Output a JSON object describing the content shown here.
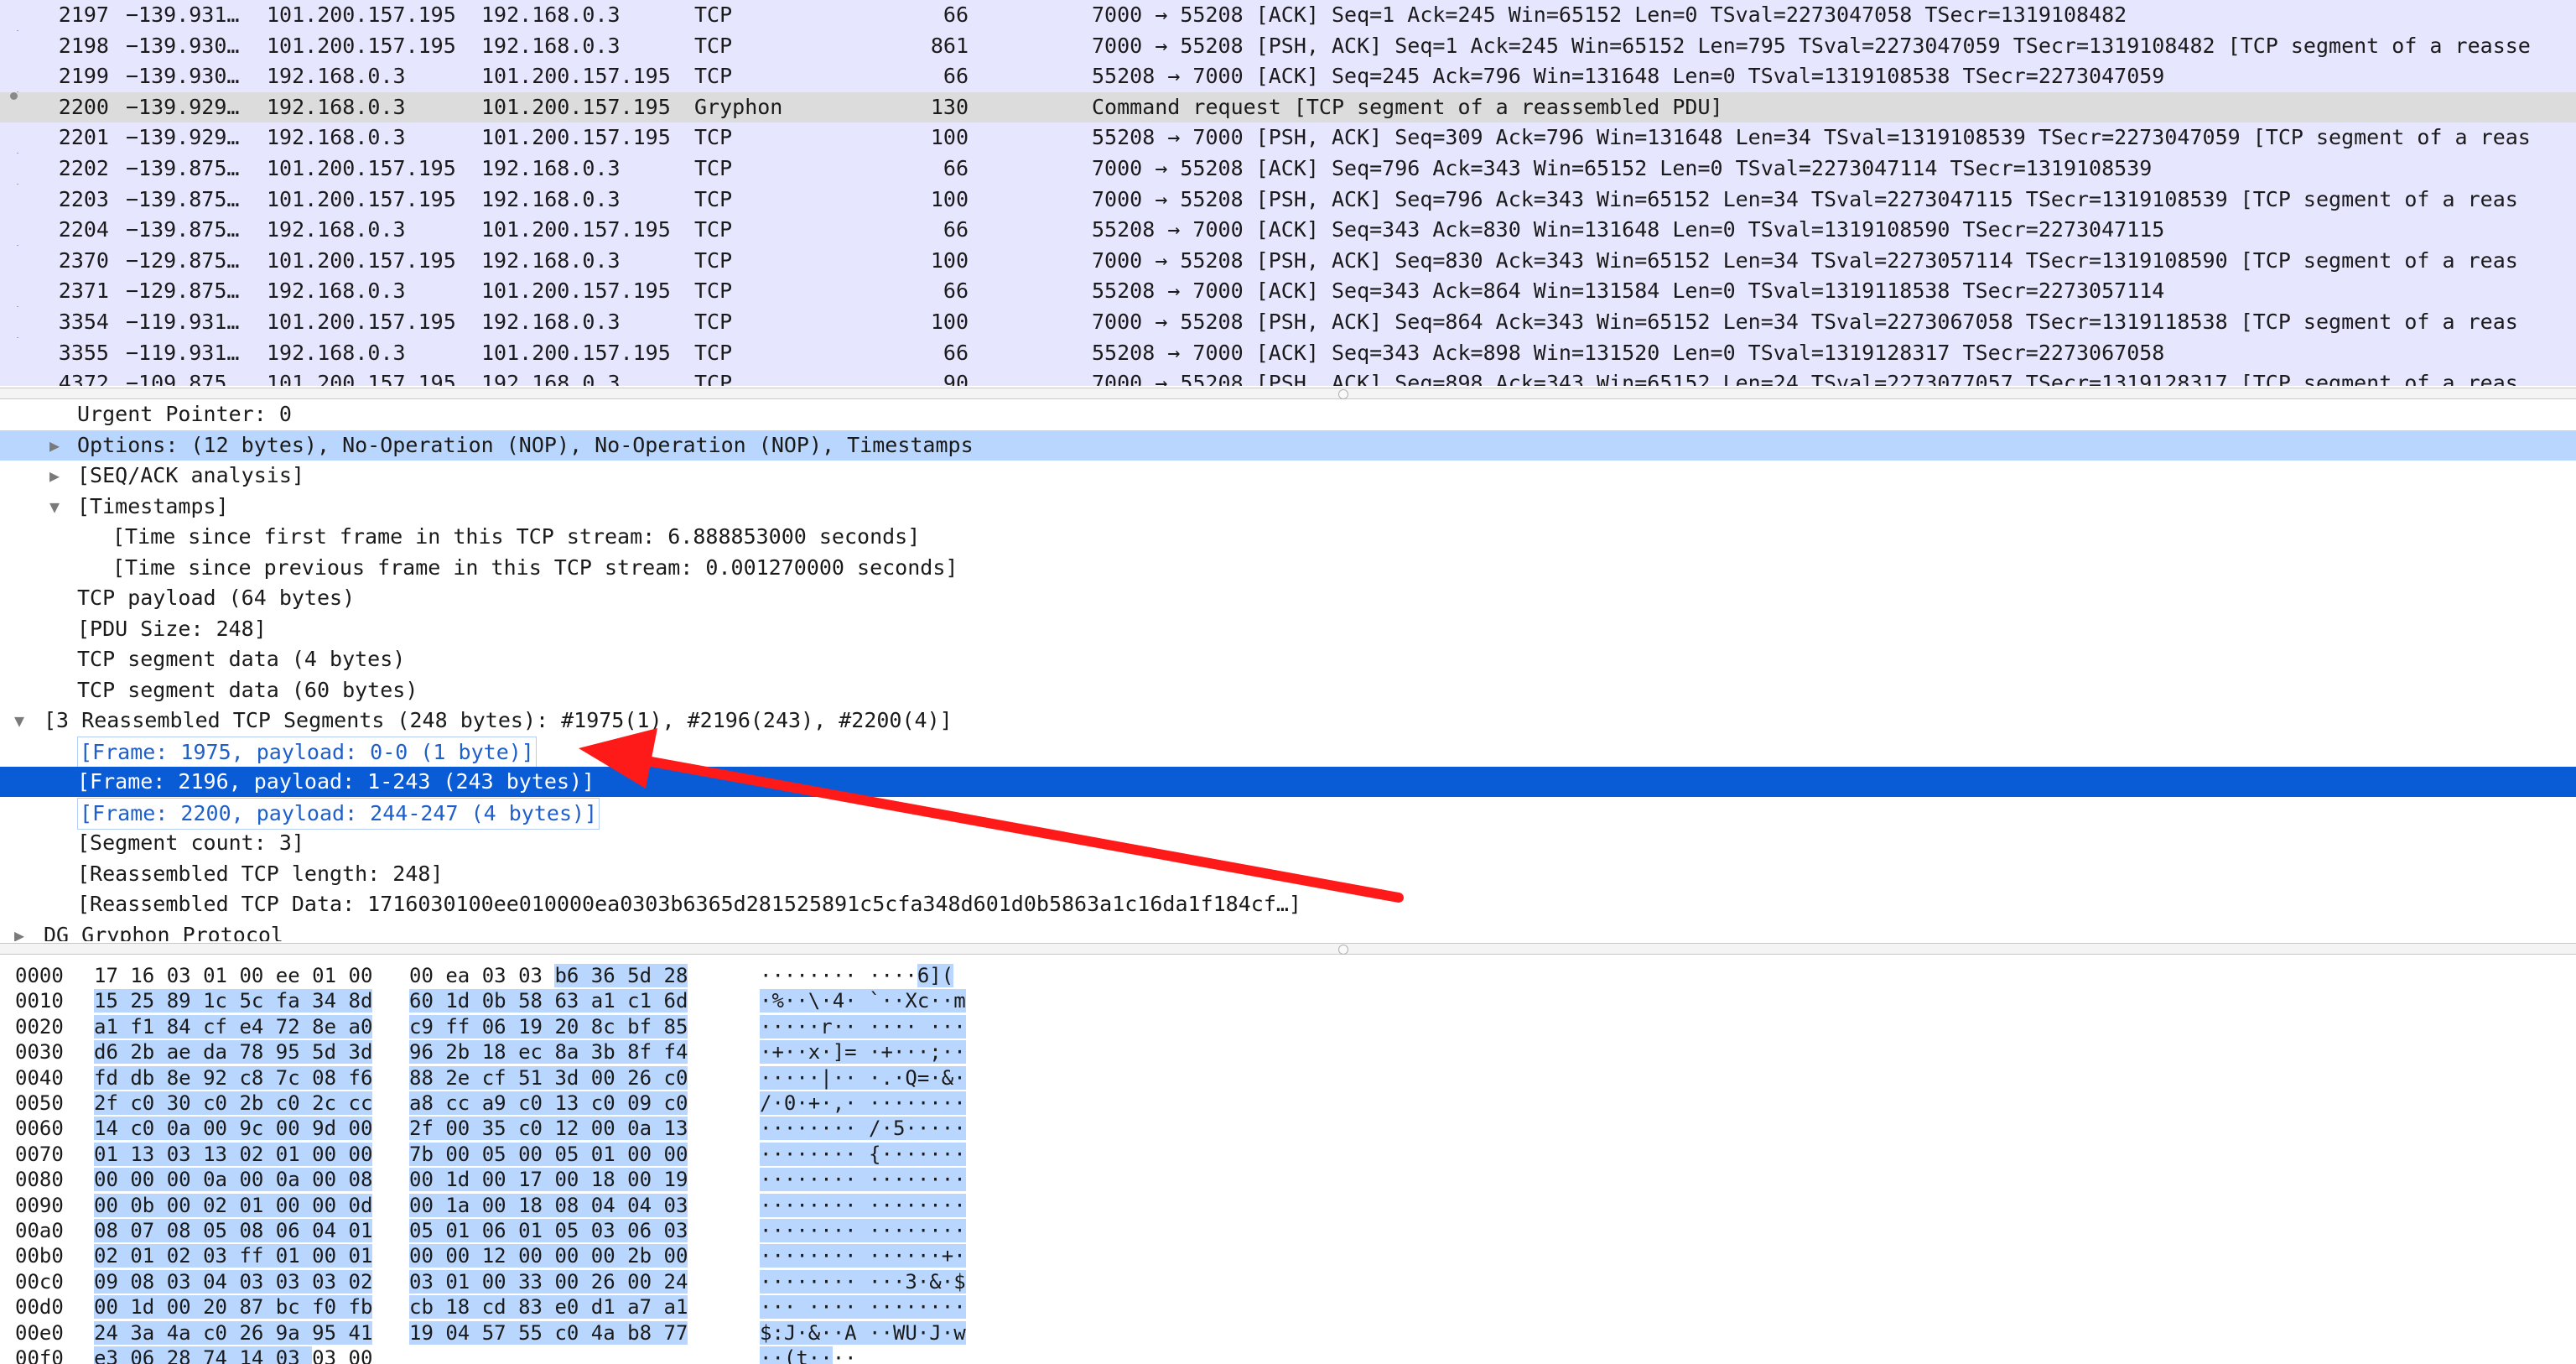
{
  "packet_list": {
    "rows": [
      {
        "no": "2197",
        "time": "−139.931…",
        "src": "101.200.157.195",
        "dst": "192.168.0.3",
        "proto": "TCP",
        "len": "66",
        "info": "7000 → 55208 [ACK] Seq=1 Ack=245 Win=65152 Len=0 TSval=2273047058 TSecr=1319108482"
      },
      {
        "no": "2198",
        "time": "−139.930…",
        "src": "101.200.157.195",
        "dst": "192.168.0.3",
        "proto": "TCP",
        "len": "861",
        "info": "7000 → 55208 [PSH, ACK] Seq=1 Ack=245 Win=65152 Len=795 TSval=2273047059 TSecr=1319108482 [TCP segment of a reasse"
      },
      {
        "no": "2199",
        "time": "−139.930…",
        "src": "192.168.0.3",
        "dst": "101.200.157.195",
        "proto": "TCP",
        "len": "66",
        "info": "55208 → 7000 [ACK] Seq=245 Ack=796 Win=131648 Len=0 TSval=1319108538 TSecr=2273047059"
      },
      {
        "no": "2200",
        "time": "−139.929…",
        "src": "192.168.0.3",
        "dst": "101.200.157.195",
        "proto": "Gryphon",
        "len": "130",
        "info": "Command request [TCP segment of a reassembled PDU]",
        "selected": true
      },
      {
        "no": "2201",
        "time": "−139.929…",
        "src": "192.168.0.3",
        "dst": "101.200.157.195",
        "proto": "TCP",
        "len": "100",
        "info": "55208 → 7000 [PSH, ACK] Seq=309 Ack=796 Win=131648 Len=34 TSval=1319108539 TSecr=2273047059 [TCP segment of a reas"
      },
      {
        "no": "2202",
        "time": "−139.875…",
        "src": "101.200.157.195",
        "dst": "192.168.0.3",
        "proto": "TCP",
        "len": "66",
        "info": "7000 → 55208 [ACK] Seq=796 Ack=343 Win=65152 Len=0 TSval=2273047114 TSecr=1319108539"
      },
      {
        "no": "2203",
        "time": "−139.875…",
        "src": "101.200.157.195",
        "dst": "192.168.0.3",
        "proto": "TCP",
        "len": "100",
        "info": "7000 → 55208 [PSH, ACK] Seq=796 Ack=343 Win=65152 Len=34 TSval=2273047115 TSecr=1319108539 [TCP segment of a reas"
      },
      {
        "no": "2204",
        "time": "−139.875…",
        "src": "192.168.0.3",
        "dst": "101.200.157.195",
        "proto": "TCP",
        "len": "66",
        "info": "55208 → 7000 [ACK] Seq=343 Ack=830 Win=131648 Len=0 TSval=1319108590 TSecr=2273047115"
      },
      {
        "no": "2370",
        "time": "−129.875…",
        "src": "101.200.157.195",
        "dst": "192.168.0.3",
        "proto": "TCP",
        "len": "100",
        "info": "7000 → 55208 [PSH, ACK] Seq=830 Ack=343 Win=65152 Len=34 TSval=2273057114 TSecr=1319108590 [TCP segment of a reas"
      },
      {
        "no": "2371",
        "time": "−129.875…",
        "src": "192.168.0.3",
        "dst": "101.200.157.195",
        "proto": "TCP",
        "len": "66",
        "info": "55208 → 7000 [ACK] Seq=343 Ack=864 Win=131584 Len=0 TSval=1319118538 TSecr=2273057114"
      },
      {
        "no": "3354",
        "time": "−119.931…",
        "src": "101.200.157.195",
        "dst": "192.168.0.3",
        "proto": "TCP",
        "len": "100",
        "info": "7000 → 55208 [PSH, ACK] Seq=864 Ack=343 Win=65152 Len=34 TSval=2273067058 TSecr=1319118538 [TCP segment of a reas"
      },
      {
        "no": "3355",
        "time": "−119.931…",
        "src": "192.168.0.3",
        "dst": "101.200.157.195",
        "proto": "TCP",
        "len": "66",
        "info": "55208 → 7000 [ACK] Seq=343 Ack=898 Win=131520 Len=0 TSval=1319128317 TSecr=2273067058"
      },
      {
        "no": "4372",
        "time": "−109.875…",
        "src": "101.200.157.195",
        "dst": "192.168.0.3",
        "proto": "TCP",
        "len": "90",
        "info": "7000 → 55208 [PSH, ACK] Seq=898 Ack=343 Win=65152 Len=24 TSval=2273077057 TSecr=1319128317 [TCP segment of a reas"
      }
    ]
  },
  "details": {
    "rows": [
      {
        "text": "Urgent Pointer: 0",
        "depth": 1,
        "arrow": "none",
        "style": "plain"
      },
      {
        "text": "Options: (12 bytes), No-Operation (NOP), No-Operation (NOP), Timestamps",
        "depth": 1,
        "arrow": "collapsed",
        "style": "hl"
      },
      {
        "text": "[SEQ/ACK analysis]",
        "depth": 1,
        "arrow": "collapsed",
        "style": "plain"
      },
      {
        "text": "[Timestamps]",
        "depth": 1,
        "arrow": "expanded",
        "style": "plain"
      },
      {
        "text": "[Time since first frame in this TCP stream: 6.888853000 seconds]",
        "depth": 2,
        "arrow": "none",
        "style": "plain"
      },
      {
        "text": "[Time since previous frame in this TCP stream: 0.001270000 seconds]",
        "depth": 2,
        "arrow": "none",
        "style": "plain"
      },
      {
        "text": "TCP payload (64 bytes)",
        "depth": 1,
        "arrow": "none",
        "style": "plain"
      },
      {
        "text": "[PDU Size: 248]",
        "depth": 1,
        "arrow": "none",
        "style": "plain"
      },
      {
        "text": "TCP segment data (4 bytes)",
        "depth": 1,
        "arrow": "none",
        "style": "plain"
      },
      {
        "text": "TCP segment data (60 bytes)",
        "depth": 1,
        "arrow": "none",
        "style": "plain"
      },
      {
        "text": "[3 Reassembled TCP Segments (248 bytes): #1975(1), #2196(243), #2200(4)]",
        "depth": 0,
        "arrow": "expanded",
        "style": "plain"
      },
      {
        "text": "[Frame: 1975, payload: 0-0 (1 byte)]",
        "depth": 1,
        "arrow": "none",
        "style": "link"
      },
      {
        "text": "[Frame: 2196, payload: 1-243 (243 bytes)]",
        "depth": 1,
        "arrow": "none",
        "style": "selected"
      },
      {
        "text": "[Frame: 2200, payload: 244-247 (4 bytes)]",
        "depth": 1,
        "arrow": "none",
        "style": "link"
      },
      {
        "text": "[Segment count: 3]",
        "depth": 1,
        "arrow": "none",
        "style": "plain"
      },
      {
        "text": "[Reassembled TCP length: 248]",
        "depth": 1,
        "arrow": "none",
        "style": "plain"
      },
      {
        "text": "[Reassembled TCP Data: 1716030100ee010000ea0303b6365d281525891c5cfa348d601d0b5863a1c16da1f184cf…]",
        "depth": 1,
        "arrow": "none",
        "style": "plain"
      },
      {
        "text": "DG Gryphon Protocol",
        "depth": 0,
        "arrow": "collapsed",
        "style": "plain"
      }
    ]
  },
  "hex_dump": {
    "rows": [
      {
        "offset": "0000",
        "a": "17 16 03 01 00 ee 01 00",
        "b": "00 ea 03 03 b6 36 5d 28",
        "ascii": "········ ····6](",
        "hl_from": 12
      },
      {
        "offset": "0010",
        "a": "15 25 89 1c 5c fa 34 8d",
        "b": "60 1d 0b 58 63 a1 c1 6d",
        "ascii": "·%··\\·4· `··Xc··m",
        "hl_from": 0
      },
      {
        "offset": "0020",
        "a": "a1 f1 84 cf e4 72 8e a0",
        "b": "c9 ff 06 19 20 8c bf 85",
        "ascii": "·····r·· ···· ···",
        "hl_from": 0
      },
      {
        "offset": "0030",
        "a": "d6 2b ae da 78 95 5d 3d",
        "b": "96 2b 18 ec 8a 3b 8f f4",
        "ascii": "·+··x·]= ·+···;··",
        "hl_from": 0
      },
      {
        "offset": "0040",
        "a": "fd db 8e 92 c8 7c 08 f6",
        "b": "88 2e cf 51 3d 00 26 c0",
        "ascii": "·····|·· ·.·Q=·&·",
        "hl_from": 0
      },
      {
        "offset": "0050",
        "a": "2f c0 30 c0 2b c0 2c cc",
        "b": "a8 cc a9 c0 13 c0 09 c0",
        "ascii": "/·0·+·,· ········",
        "hl_from": 0
      },
      {
        "offset": "0060",
        "a": "14 c0 0a 00 9c 00 9d 00",
        "b": "2f 00 35 c0 12 00 0a 13",
        "ascii": "········ /·5·····",
        "hl_from": 0
      },
      {
        "offset": "0070",
        "a": "01 13 03 13 02 01 00 00",
        "b": "7b 00 05 00 05 01 00 00",
        "ascii": "········ {·······",
        "hl_from": 0
      },
      {
        "offset": "0080",
        "a": "00 00 00 0a 00 0a 00 08",
        "b": "00 1d 00 17 00 18 00 19",
        "ascii": "········ ········",
        "hl_from": 0
      },
      {
        "offset": "0090",
        "a": "00 0b 00 02 01 00 00 0d",
        "b": "00 1a 00 18 08 04 04 03",
        "ascii": "········ ········",
        "hl_from": 0
      },
      {
        "offset": "00a0",
        "a": "08 07 08 05 08 06 04 01",
        "b": "05 01 06 01 05 03 06 03",
        "ascii": "········ ········",
        "hl_from": 0
      },
      {
        "offset": "00b0",
        "a": "02 01 02 03 ff 01 00 01",
        "b": "00 00 12 00 00 00 2b 00",
        "ascii": "········ ······+·",
        "hl_from": 0
      },
      {
        "offset": "00c0",
        "a": "09 08 03 04 03 03 03 02",
        "b": "03 01 00 33 00 26 00 24",
        "ascii": "········ ···3·&·$",
        "hl_from": 0
      },
      {
        "offset": "00d0",
        "a": "00 1d 00 20 87 bc f0 fb",
        "b": "cb 18 cd 83 e0 d1 a7 a1",
        "ascii": "··· ···· ········",
        "hl_from": 0
      },
      {
        "offset": "00e0",
        "a": "24 3a 4a c0 26 9a 95 41",
        "b": "19 04 57 55 c0 4a b8 77",
        "ascii": "$:J·&··A ··WU·J·w",
        "hl_from": 0
      },
      {
        "offset": "00f0",
        "a": "e3 06 28 74 14 03 03 00",
        "b": "",
        "ascii": "··(t····",
        "hl_to": 5
      }
    ]
  },
  "colors": {
    "packet_list_bg": "#e7e6ff",
    "selected_row_bg": "#0a5bd6",
    "highlight_bg": "#b9d6ff",
    "annotation_arrow": "#ff1a1a"
  }
}
